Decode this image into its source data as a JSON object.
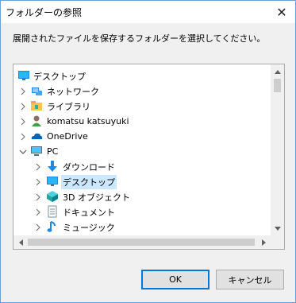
{
  "window": {
    "title": "フォルダーの参照",
    "close_glyph": "✕"
  },
  "instruction": "展開されたファイルを保存するフォルダーを選択してください。",
  "tree": {
    "items": [
      {
        "label": "デスクトップ",
        "icon": "desktop-icon"
      },
      {
        "label": "ネットワーク",
        "icon": "network-icon"
      },
      {
        "label": "ライブラリ",
        "icon": "library-icon"
      },
      {
        "label": "komatsu katsuyuki",
        "icon": "user-icon"
      },
      {
        "label": "OneDrive",
        "icon": "onedrive-icon"
      },
      {
        "label": "PC",
        "icon": "pc-icon"
      },
      {
        "label": "ダウンロード",
        "icon": "downloads-icon"
      },
      {
        "label": "デスクトップ",
        "icon": "desktop-icon",
        "selected": true
      },
      {
        "label": "3D オブジェクト",
        "icon": "3d-objects-icon"
      },
      {
        "label": "ドキュメント",
        "icon": "documents-icon"
      },
      {
        "label": "ミュージック",
        "icon": "music-icon"
      }
    ]
  },
  "buttons": {
    "ok": "OK",
    "cancel": "キャンセル"
  },
  "colors": {
    "selection": "#cce8ff",
    "accent": "#0078d7"
  }
}
